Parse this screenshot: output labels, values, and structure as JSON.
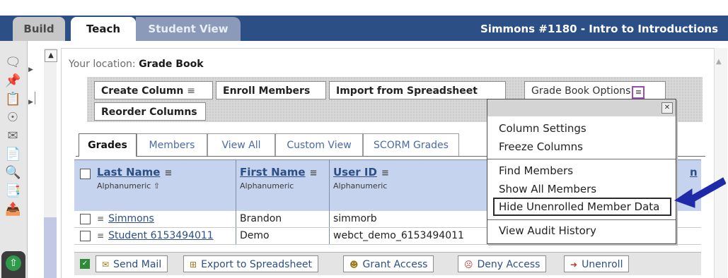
{
  "tabs": {
    "build": "Build",
    "teach": "Teach",
    "student_view": "Student View"
  },
  "course_title": "Simmons #1180 - Intro to Introductions",
  "location": {
    "prefix": "Your location:",
    "page": "Grade Book"
  },
  "toolbar": {
    "create_column": "Create Column",
    "enroll_members": "Enroll Members",
    "import_spreadsheet": "Import from Spreadsheet",
    "reorder_columns": "Reorder Columns",
    "grade_book_options": "Grade Book Options"
  },
  "subtabs": [
    "Grades",
    "Members",
    "View All",
    "Custom View",
    "SCORM Grades"
  ],
  "grid": {
    "columns": [
      {
        "title": "Last Name",
        "sub": "Alphanumeric ⇧"
      },
      {
        "title": "First Name",
        "sub": "Alphanumeric"
      },
      {
        "title": "User ID",
        "sub": "Alphanumeric"
      }
    ],
    "right_edge_fragment": "n",
    "rows": [
      {
        "last": "Simmons",
        "first": "Brandon",
        "user": "simmorb"
      },
      {
        "last": "Student 6153494011",
        "first": "Demo",
        "user": "webct_demo_6153494011",
        "extra1": "--",
        "extra2": "--"
      }
    ]
  },
  "actions": {
    "send_mail": "Send Mail",
    "export": "Export to Spreadsheet",
    "grant": "Grant Access",
    "deny": "Deny Access",
    "unenroll": "Unenroll"
  },
  "dropdown": {
    "items": [
      "Column Settings",
      "Freeze Columns",
      "Find Members",
      "Show All Members",
      "Hide Unenrolled Member Data",
      "View Audit History"
    ],
    "highlighted": "Hide Unenrolled Member Data"
  },
  "colors": {
    "top_band": "#2c4f86",
    "grid_header": "#c6d3ee",
    "link": "#2c4f86",
    "arrow": "#1e2aa8"
  }
}
